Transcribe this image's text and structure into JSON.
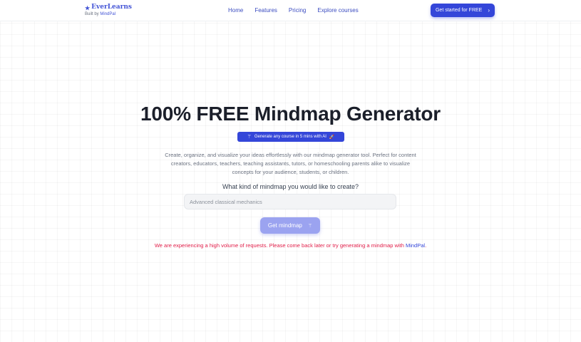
{
  "header": {
    "logo_name": "EverLearns",
    "logo_icon": "star-icon",
    "built_by_prefix": "Built by",
    "built_by_brand": "MindPal",
    "nav": [
      {
        "label": "Home"
      },
      {
        "label": "Features"
      },
      {
        "label": "Pricing"
      },
      {
        "label": "Explore courses"
      }
    ],
    "cta_label": "Get started for FREE",
    "cta_icon": "chevron-right-icon"
  },
  "hero": {
    "title": "100% FREE Mindmap Generator",
    "badge_label": "Generate any course in 5 mins with AI",
    "badge_icon": "magic-wand-icon",
    "badge_emoji": "🚀",
    "description": "Create, organize, and visualize your ideas effortlessly with our mindmap generator tool. Perfect for content creators, educators, teachers, teaching assistants, tutors, or homeschooling parents alike to visualize concepts for your audience, students, or children.",
    "question": "What kind of mindmap you would like to create?",
    "input_placeholder": "Advanced classical mechanics",
    "input_value": "",
    "button_label": "Get mindmap",
    "button_icon": "magic-wand-icon"
  },
  "error": {
    "text": "We are experiencing a high volume of requests. Please come back later or try generating a mindmap with",
    "link_label": "MindPal",
    "suffix": "."
  },
  "colors": {
    "primary": "#3446d9",
    "button_disabled": "#9ba3f0",
    "error": "#e11d48"
  }
}
